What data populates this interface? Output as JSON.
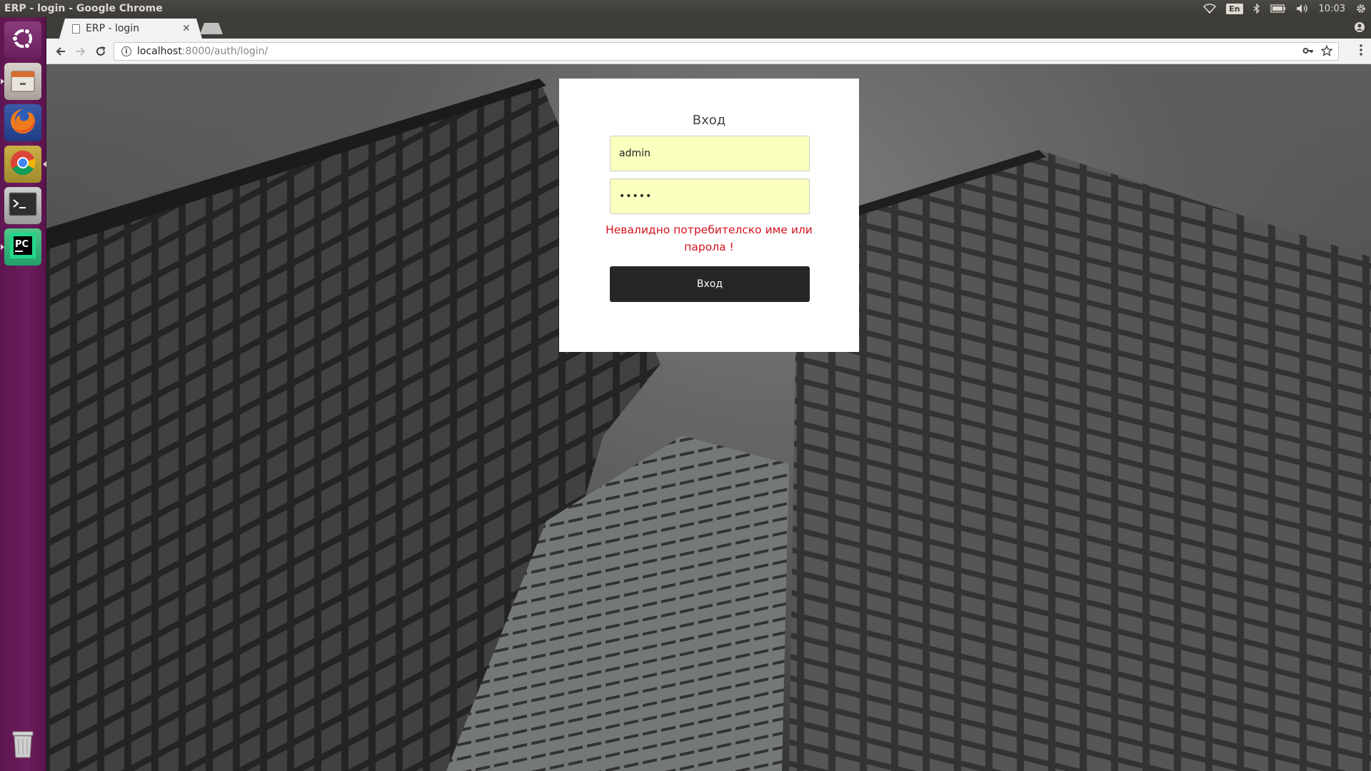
{
  "system": {
    "window_title": "ERP - login - Google Chrome",
    "keyboard_layout": "En",
    "clock": "10:03"
  },
  "launcher": {
    "items": [
      {
        "name": "ubuntu-dash",
        "icon": "ubuntu-logo-icon"
      },
      {
        "name": "files",
        "icon": "file-cabinet-icon"
      },
      {
        "name": "firefox",
        "icon": "firefox-icon"
      },
      {
        "name": "chrome",
        "icon": "chrome-icon"
      },
      {
        "name": "terminal",
        "icon": "terminal-icon"
      },
      {
        "name": "pycharm",
        "icon": "pycharm-icon",
        "label": "PC"
      },
      {
        "name": "trash",
        "icon": "trash-icon"
      }
    ]
  },
  "browser": {
    "tab_title": "ERP - login",
    "url_host": "localhost",
    "url_rest": ":8000/auth/login/"
  },
  "login": {
    "title": "Вход",
    "username_value": "admin",
    "password_value": "•••••",
    "error": "Невалидно потребителско име или парола !",
    "submit_label": "Вход",
    "input_bg": "#faffbd",
    "error_color": "#d4111d"
  }
}
